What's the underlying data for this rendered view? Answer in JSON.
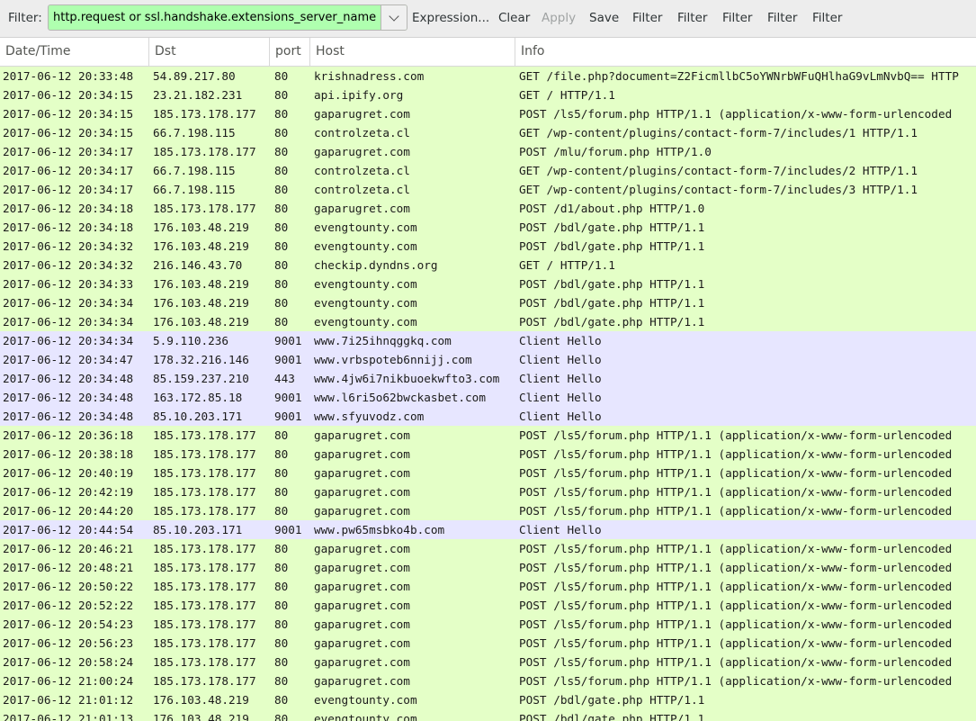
{
  "toolbar": {
    "filter_label": "Filter:",
    "filter_value": "http.request or ssl.handshake.extensions_server_name",
    "expression_label": "Expression...",
    "clear_label": "Clear",
    "apply_label": "Apply",
    "save_label": "Save",
    "filter_buttons": [
      "Filter",
      "Filter",
      "Filter",
      "Filter",
      "Filter"
    ]
  },
  "columns": [
    "Date/Time",
    "Dst",
    "port",
    "Host",
    "Info"
  ],
  "colors": {
    "http_row": "#e4ffc7",
    "tls_row": "#e7e6ff",
    "filter_valid": "#afffaf"
  },
  "rows": [
    [
      "2017-06-12 20:33:48",
      "54.89.217.80",
      "80",
      "krishnadress.com",
      "GET /file.php?document=Z2FicmllbC5oYWNrbWFuQHlhaG9vLmNvbQ== HTTP"
    ],
    [
      "2017-06-12 20:34:15",
      "23.21.182.231",
      "80",
      "api.ipify.org",
      "GET / HTTP/1.1"
    ],
    [
      "2017-06-12 20:34:15",
      "185.173.178.177",
      "80",
      "gaparugret.com",
      "POST /ls5/forum.php HTTP/1.1  (application/x-www-form-urlencoded"
    ],
    [
      "2017-06-12 20:34:15",
      "66.7.198.115",
      "80",
      "controlzeta.cl",
      "GET /wp-content/plugins/contact-form-7/includes/1 HTTP/1.1"
    ],
    [
      "2017-06-12 20:34:17",
      "185.173.178.177",
      "80",
      "gaparugret.com",
      "POST /mlu/forum.php HTTP/1.0"
    ],
    [
      "2017-06-12 20:34:17",
      "66.7.198.115",
      "80",
      "controlzeta.cl",
      "GET /wp-content/plugins/contact-form-7/includes/2 HTTP/1.1"
    ],
    [
      "2017-06-12 20:34:17",
      "66.7.198.115",
      "80",
      "controlzeta.cl",
      "GET /wp-content/plugins/contact-form-7/includes/3 HTTP/1.1"
    ],
    [
      "2017-06-12 20:34:18",
      "185.173.178.177",
      "80",
      "gaparugret.com",
      "POST /d1/about.php HTTP/1.0"
    ],
    [
      "2017-06-12 20:34:18",
      "176.103.48.219",
      "80",
      "evengtounty.com",
      "POST /bdl/gate.php HTTP/1.1"
    ],
    [
      "2017-06-12 20:34:32",
      "176.103.48.219",
      "80",
      "evengtounty.com",
      "POST /bdl/gate.php HTTP/1.1"
    ],
    [
      "2017-06-12 20:34:32",
      "216.146.43.70",
      "80",
      "checkip.dyndns.org",
      "GET / HTTP/1.1"
    ],
    [
      "2017-06-12 20:34:33",
      "176.103.48.219",
      "80",
      "evengtounty.com",
      "POST /bdl/gate.php HTTP/1.1"
    ],
    [
      "2017-06-12 20:34:34",
      "176.103.48.219",
      "80",
      "evengtounty.com",
      "POST /bdl/gate.php HTTP/1.1"
    ],
    [
      "2017-06-12 20:34:34",
      "176.103.48.219",
      "80",
      "evengtounty.com",
      "POST /bdl/gate.php HTTP/1.1"
    ],
    [
      "2017-06-12 20:34:34",
      "5.9.110.236",
      "9001",
      "www.7i25ihnqggkq.com",
      "Client Hello"
    ],
    [
      "2017-06-12 20:34:47",
      "178.32.216.146",
      "9001",
      "www.vrbspoteb6nnijj.com",
      "Client Hello"
    ],
    [
      "2017-06-12 20:34:48",
      "85.159.237.210",
      "443",
      "www.4jw6i7nikbuoekwfto3.com",
      "Client Hello"
    ],
    [
      "2017-06-12 20:34:48",
      "163.172.85.18",
      "9001",
      "www.l6ri5o62bwckasbet.com",
      "Client Hello"
    ],
    [
      "2017-06-12 20:34:48",
      "85.10.203.171",
      "9001",
      "www.sfyuvodz.com",
      "Client Hello"
    ],
    [
      "2017-06-12 20:36:18",
      "185.173.178.177",
      "80",
      "gaparugret.com",
      "POST /ls5/forum.php HTTP/1.1  (application/x-www-form-urlencoded"
    ],
    [
      "2017-06-12 20:38:18",
      "185.173.178.177",
      "80",
      "gaparugret.com",
      "POST /ls5/forum.php HTTP/1.1  (application/x-www-form-urlencoded"
    ],
    [
      "2017-06-12 20:40:19",
      "185.173.178.177",
      "80",
      "gaparugret.com",
      "POST /ls5/forum.php HTTP/1.1  (application/x-www-form-urlencoded"
    ],
    [
      "2017-06-12 20:42:19",
      "185.173.178.177",
      "80",
      "gaparugret.com",
      "POST /ls5/forum.php HTTP/1.1  (application/x-www-form-urlencoded"
    ],
    [
      "2017-06-12 20:44:20",
      "185.173.178.177",
      "80",
      "gaparugret.com",
      "POST /ls5/forum.php HTTP/1.1  (application/x-www-form-urlencoded"
    ],
    [
      "2017-06-12 20:44:54",
      "85.10.203.171",
      "9001",
      "www.pw65msbko4b.com",
      "Client Hello"
    ],
    [
      "2017-06-12 20:46:21",
      "185.173.178.177",
      "80",
      "gaparugret.com",
      "POST /ls5/forum.php HTTP/1.1  (application/x-www-form-urlencoded"
    ],
    [
      "2017-06-12 20:48:21",
      "185.173.178.177",
      "80",
      "gaparugret.com",
      "POST /ls5/forum.php HTTP/1.1  (application/x-www-form-urlencoded"
    ],
    [
      "2017-06-12 20:50:22",
      "185.173.178.177",
      "80",
      "gaparugret.com",
      "POST /ls5/forum.php HTTP/1.1  (application/x-www-form-urlencoded"
    ],
    [
      "2017-06-12 20:52:22",
      "185.173.178.177",
      "80",
      "gaparugret.com",
      "POST /ls5/forum.php HTTP/1.1  (application/x-www-form-urlencoded"
    ],
    [
      "2017-06-12 20:54:23",
      "185.173.178.177",
      "80",
      "gaparugret.com",
      "POST /ls5/forum.php HTTP/1.1  (application/x-www-form-urlencoded"
    ],
    [
      "2017-06-12 20:56:23",
      "185.173.178.177",
      "80",
      "gaparugret.com",
      "POST /ls5/forum.php HTTP/1.1  (application/x-www-form-urlencoded"
    ],
    [
      "2017-06-12 20:58:24",
      "185.173.178.177",
      "80",
      "gaparugret.com",
      "POST /ls5/forum.php HTTP/1.1  (application/x-www-form-urlencoded"
    ],
    [
      "2017-06-12 21:00:24",
      "185.173.178.177",
      "80",
      "gaparugret.com",
      "POST /ls5/forum.php HTTP/1.1  (application/x-www-form-urlencoded"
    ],
    [
      "2017-06-12 21:01:12",
      "176.103.48.219",
      "80",
      "evengtounty.com",
      "POST /bdl/gate.php HTTP/1.1"
    ],
    [
      "2017-06-12 21:01:13",
      "176.103.48.219",
      "80",
      "evengtounty.com",
      "POST /bdl/gate.php HTTP/1.1"
    ]
  ]
}
